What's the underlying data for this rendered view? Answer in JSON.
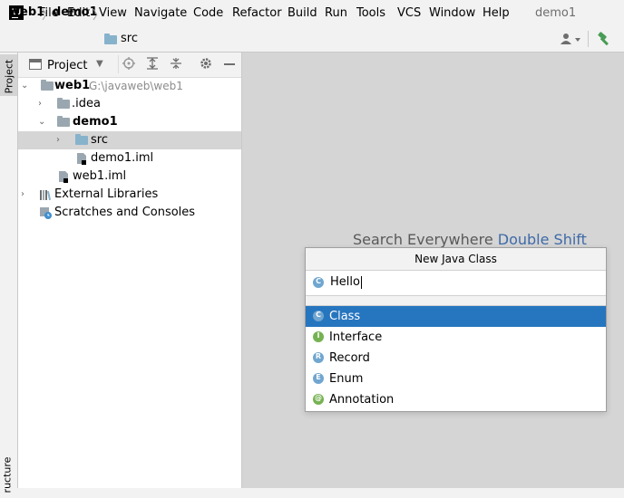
{
  "menu": {
    "items": [
      "File",
      "Edit",
      "View",
      "Navigate",
      "Code",
      "Refactor",
      "Build",
      "Run",
      "Tools",
      "VCS",
      "Window",
      "Help"
    ],
    "window_title": "demo1"
  },
  "navbar": {
    "crumbs": [
      "web1",
      "demo1",
      "src"
    ]
  },
  "tool_strip": {
    "project_label": "Project",
    "structure_label": "ructure"
  },
  "project_panel": {
    "title": "Project",
    "tree": [
      {
        "label": "web1",
        "path": "G:\\javaweb\\web1"
      },
      {
        "label": ".idea"
      },
      {
        "label": "demo1"
      },
      {
        "label": "src"
      },
      {
        "label": "demo1.iml"
      },
      {
        "label": "web1.iml"
      },
      {
        "label": "External Libraries"
      },
      {
        "label": "Scratches and Consoles"
      }
    ]
  },
  "editor": {
    "hint_text": "Search Everywhere",
    "hint_key": "Double Shift"
  },
  "popup": {
    "title": "New Java Class",
    "input_value": "Hello",
    "input_icon": "C",
    "options": [
      {
        "icon": "C",
        "label": "Class",
        "selected": true
      },
      {
        "icon": "I",
        "label": "Interface"
      },
      {
        "icon": "R",
        "label": "Record"
      },
      {
        "icon": "E",
        "label": "Enum"
      },
      {
        "icon": "@",
        "label": "Annotation"
      }
    ]
  },
  "colors": {
    "selection": "#2675bf",
    "editor_bg": "#d5d5d5",
    "folder_blue": "#87b2cc",
    "hint_key": "#3e6aa8"
  }
}
